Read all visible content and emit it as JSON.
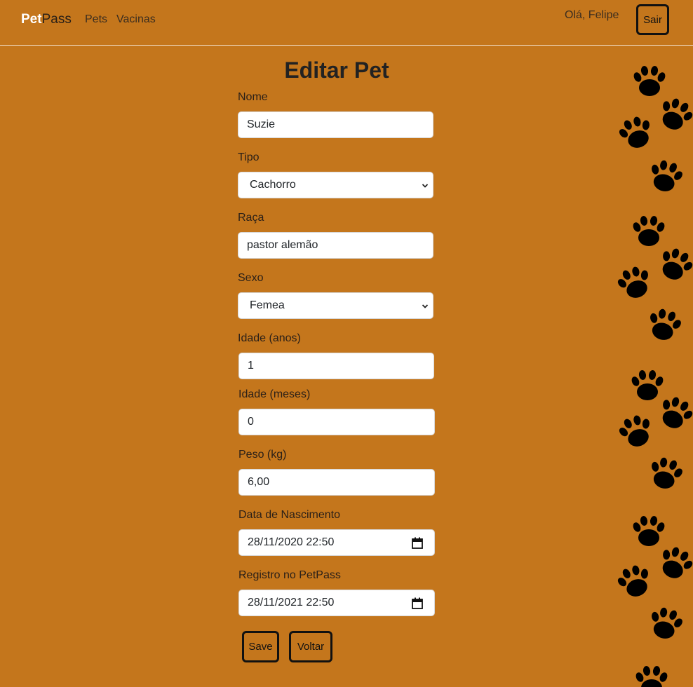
{
  "nav": {
    "brand_bold": "Pet",
    "brand_rest": "Pass",
    "links": [
      "Pets",
      "Vacinas"
    ],
    "greeting": "Olá, Felipe",
    "logout_label": "Sair"
  },
  "form": {
    "title": "Editar Pet",
    "nome": {
      "label": "Nome",
      "value": "Suzie"
    },
    "tipo": {
      "label": "Tipo",
      "value": "Cachorro"
    },
    "raca": {
      "label": "Raça",
      "value": "pastor alemão"
    },
    "sexo": {
      "label": "Sexo",
      "value": "Femea"
    },
    "idade_anos": {
      "label": "Idade (anos)",
      "value": "1"
    },
    "idade_meses": {
      "label": "Idade (meses)",
      "value": "0"
    },
    "peso": {
      "label": "Peso (kg)",
      "value": "6,00"
    },
    "nascimento": {
      "label": "Data de Nascimento",
      "value": "28/11/2020 22:50"
    },
    "registro": {
      "label": "Registro no PetPass",
      "value": "28/11/2021 22:50"
    },
    "save_label": "Save",
    "back_label": "Voltar"
  },
  "decor": {
    "icon": "paw-print-icon"
  },
  "colors": {
    "background": "#c4761c",
    "paw": "#000000",
    "field_bg": "#ffffff"
  }
}
